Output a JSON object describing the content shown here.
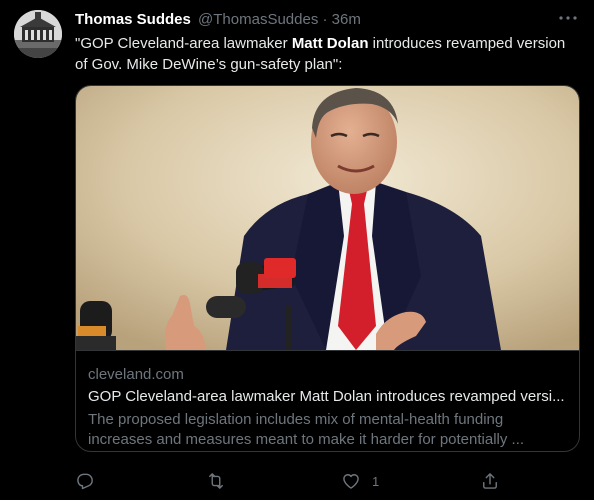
{
  "tweet": {
    "author_name": "Thomas Suddes",
    "author_handle": "@ThomasSuddes",
    "separator": "·",
    "timestamp": "36m",
    "text_part1": "\"GOP Cleveland-area lawmaker ",
    "text_bold": "Matt Dolan",
    "text_part2": " introduces revamped version of Gov. Mike DeWine’s gun-safety plan\":"
  },
  "card": {
    "domain": "cleveland.com",
    "title": "GOP Cleveland-area lawmaker Matt Dolan introduces revamped versi...",
    "description": "The proposed legislation includes mix of mental-health funding increases and measures meant to make it harder for potentially ...",
    "image": "photo-man-in-suit-red-tie-speaking-at-microphones"
  },
  "actions": {
    "reply_icon": "reply-icon",
    "retweet_icon": "retweet-icon",
    "like_icon": "like-icon",
    "like_count": "1",
    "share_icon": "share-icon"
  },
  "colors": {
    "background": "#000000",
    "primary_text": "#e7e9ea",
    "secondary_text": "#6e767d",
    "border": "#333639"
  }
}
